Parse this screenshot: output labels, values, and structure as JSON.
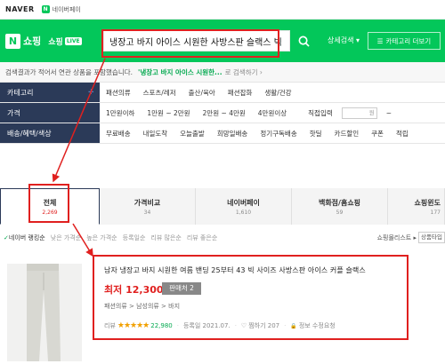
{
  "topbar": {
    "brand": "NAVER",
    "pay_label": "네이버페이",
    "pay_icon": "N"
  },
  "header": {
    "logo_letter": "N",
    "logo_text": "쇼핑",
    "live_text": "쇼핑",
    "live_tag": "LIVE",
    "search_value": "냉장고 바지 아이스 시원한 사방스판 슬랙스 빅",
    "search_icon": "search-icon",
    "detail_search": "상세검색",
    "detail_arrow": "▾",
    "category_more": "카테고리 더보기",
    "category_icon": "☰"
  },
  "notice": {
    "text": "검색결과가 적어서 연관 상품을 포함했습니다.",
    "query": "'냉장고 바지 아이스 시원한...",
    "suffix": "로 검색하기 ›"
  },
  "filters": [
    {
      "label": "카테고리",
      "plus": "+",
      "items": [
        "패션의류",
        "스포츠/레저",
        "출산/육아",
        "패션잡화",
        "생활/건강"
      ]
    },
    {
      "label": "가격",
      "items": [
        "1만원이하",
        "1만원 ~ 2만원",
        "2만원 ~ 4만원",
        "4만원이상"
      ],
      "direct_input": "직접입력",
      "unit": "원",
      "sep": "~"
    },
    {
      "label": "배송/혜택/색상",
      "items": [
        "무료배송",
        "내일도착",
        "오늘출발",
        "희망일배송",
        "정기구독배송",
        "핫딜",
        "카드할인",
        "쿠폰",
        "적립"
      ]
    }
  ],
  "tabs": [
    {
      "label": "전체",
      "count": "2,269"
    },
    {
      "label": "가격비교",
      "count": "34"
    },
    {
      "label": "네이버페이",
      "count": "1,610"
    },
    {
      "label": "백화점/홈쇼핑",
      "count": "59"
    },
    {
      "label": "쇼핑윈도",
      "count": "177"
    }
  ],
  "sort": {
    "bullet": "✓",
    "items": [
      "네이버 랭킹순",
      "낮은 가격순",
      "높은 가격순",
      "등록일순",
      "리뷰 많은순",
      "리뷰 좋은순"
    ],
    "right": "쇼핑몰리스트 ▸",
    "dropdown": "상품타입"
  },
  "product": {
    "title": "남자 냉장고 바지 시원한 여름 밴딩 25부터 43 빅 사이즈 사방스판 아이스 커플 슬랙스",
    "price_prefix": "최저",
    "price": "12,300원",
    "store_label": "판매처 2",
    "category": "패션의류 > 남성의류 > 바지",
    "review_label": "리뷰",
    "stars": "★★★★★",
    "review_count": "22,980",
    "registered": "등록일 2021.07.",
    "heart": "♡",
    "wish": "찜하기 207",
    "info_icon": "🔒",
    "report": "정보 수정요청"
  },
  "colors": {
    "naver_green": "#03c75a",
    "filter_navy": "#2b3a58",
    "highlight_red": "#e0201f"
  }
}
